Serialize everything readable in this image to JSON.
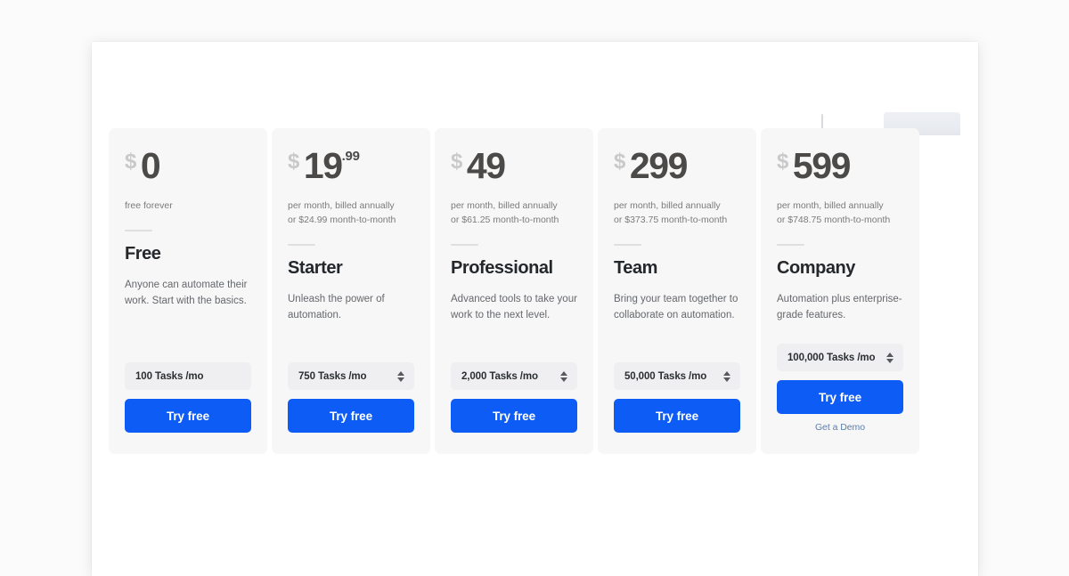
{
  "theme": {
    "page_background": "#fbfbfb",
    "sheet_background": "#ffffff",
    "card_background": "#f7f7f8",
    "accent_blue": "#0d5cf5",
    "amount_color": "#4c4a48",
    "currency_color": "#c9c9cb",
    "link_color": "#5b7faa"
  },
  "plans": [
    {
      "currency": "$",
      "amount": "0",
      "cents": "",
      "billing_primary": "free forever",
      "billing_secondary": "",
      "name": "Free",
      "description": "Anyone can automate their work. Start with the basics.",
      "tasks_label": "100 Tasks /mo",
      "has_stepper": false,
      "cta_label": "Try free",
      "demo_link": ""
    },
    {
      "currency": "$",
      "amount": "19",
      "cents": ".99",
      "billing_primary": "per month, billed annually",
      "billing_secondary": "or $24.99 month-to-month",
      "name": "Starter",
      "description": "Unleash the power of automation.",
      "tasks_label": "750 Tasks /mo",
      "has_stepper": true,
      "cta_label": "Try free",
      "demo_link": ""
    },
    {
      "currency": "$",
      "amount": "49",
      "cents": "",
      "billing_primary": "per month, billed annually",
      "billing_secondary": "or $61.25 month-to-month",
      "name": "Professional",
      "description": "Advanced tools to take your work to the next level.",
      "tasks_label": "2,000 Tasks /mo",
      "has_stepper": true,
      "cta_label": "Try free",
      "demo_link": ""
    },
    {
      "currency": "$",
      "amount": "299",
      "cents": "",
      "billing_primary": "per month, billed annually",
      "billing_secondary": "or $373.75 month-to-month",
      "name": "Team",
      "description": "Bring your team together to collaborate on automation.",
      "tasks_label": "50,000 Tasks /mo",
      "has_stepper": true,
      "cta_label": "Try free",
      "demo_link": ""
    },
    {
      "currency": "$",
      "amount": "599",
      "cents": "",
      "billing_primary": "per month, billed annually",
      "billing_secondary": "or $748.75 month-to-month",
      "name": "Company",
      "description": "Automation plus enterprise-grade features.",
      "tasks_label": "100,000 Tasks /mo",
      "has_stepper": true,
      "cta_label": "Try free",
      "demo_link": "Get a Demo"
    }
  ],
  "overlay": {
    "caret_icon": "text-caret-icon",
    "chip_icon": "ghost-chip-icon"
  }
}
